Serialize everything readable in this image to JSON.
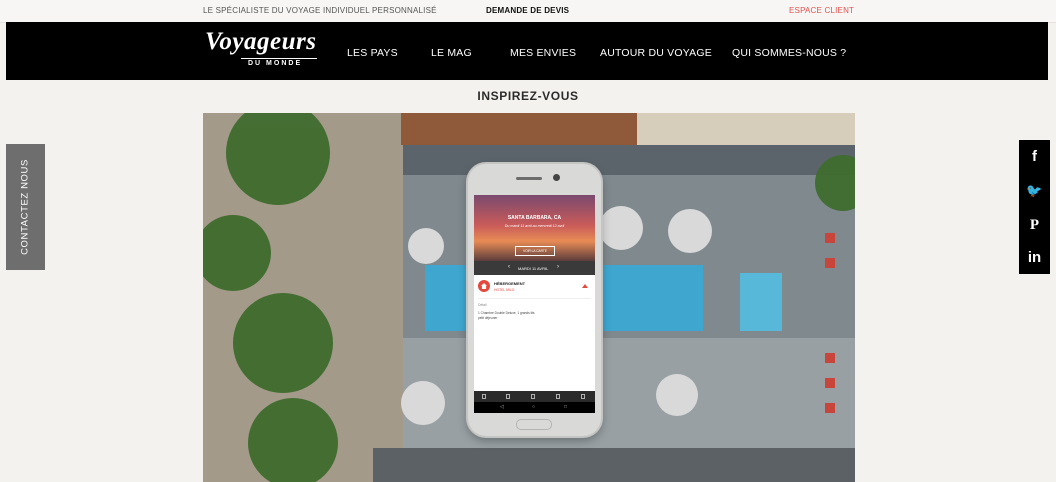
{
  "topbar": {
    "tagline": "LE SPÉCIALISTE DU VOYAGE INDIVIDUEL PERSONNALISÉ",
    "quote_link": "DEMANDE DE DEVIS",
    "client_link": "ESPACE CLIENT"
  },
  "logo": {
    "main": "Voyageurs",
    "sub": "DU MONDE"
  },
  "nav": [
    "LES PAYS",
    "LE MAG",
    "MES ENVIES",
    "AUTOUR DU VOYAGE",
    "QUI SOMMES-NOUS ?"
  ],
  "page_title": "INSPIREZ-VOUS",
  "contact_tab": "CONTACTEZ NOUS",
  "phone_app": {
    "city": "SANTA BARBARA, CA",
    "dates": "Du mardi 11 avril au mercredi 12 avril",
    "hero_button": "VOIR LA CARTE",
    "day": "MARDI 11 AVRIL",
    "category": "HÉBERGEMENT",
    "hotel": "HOTEL MILO",
    "label": "Détail",
    "detail": "1 Chambre Double Deluxe, 1 grands lits petit déjeuner",
    "nav_buttons": [
      "◁",
      "○",
      "□"
    ]
  },
  "social": [
    {
      "icon": "facebook-icon",
      "glyph": "f"
    },
    {
      "icon": "twitter-icon",
      "glyph": "🐦"
    },
    {
      "icon": "pinterest-icon",
      "glyph": "P"
    },
    {
      "icon": "linkedin-icon",
      "glyph": "in"
    }
  ],
  "colors": {
    "accent": "#e2544e",
    "nav_bg": "#000000",
    "page_bg": "#f4f2ee",
    "pool": "#3fa7cf"
  }
}
